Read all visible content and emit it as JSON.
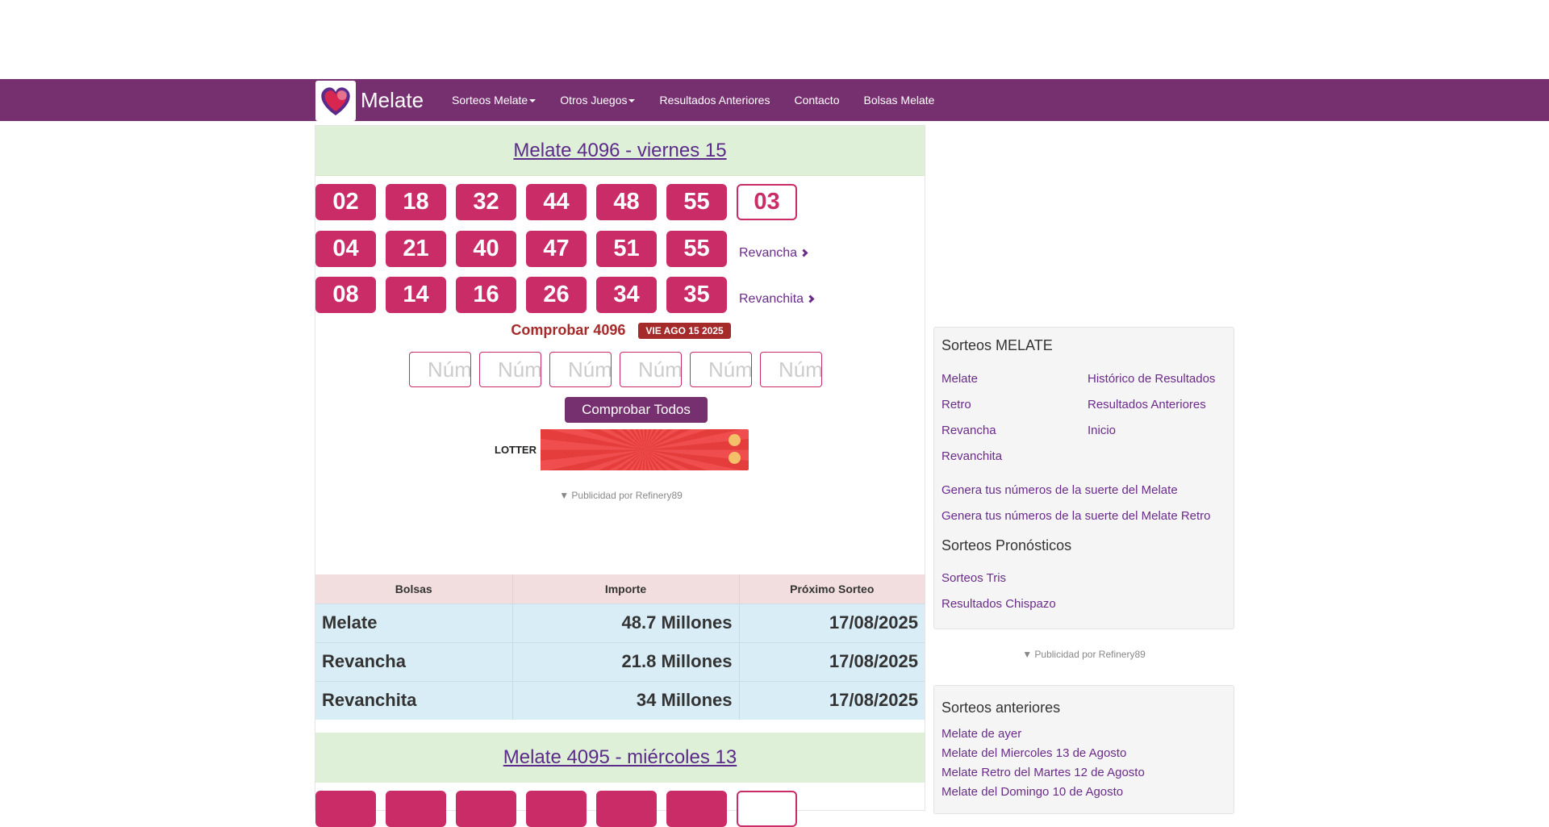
{
  "nav": {
    "brand": "Melate",
    "items": [
      "Sorteos Melate",
      "Otros Juegos",
      "Resultados Anteriores",
      "Contacto",
      "Bolsas Melate"
    ]
  },
  "draw": {
    "title": "Melate 4096 - viernes 15",
    "melate": [
      "02",
      "18",
      "32",
      "44",
      "48",
      "55"
    ],
    "extra": "03",
    "revancha": [
      "04",
      "21",
      "40",
      "47",
      "51",
      "55"
    ],
    "revancha_label": "Revancha",
    "revanchita": [
      "08",
      "14",
      "16",
      "26",
      "34",
      "35"
    ],
    "revanchita_label": "Revanchita"
  },
  "check": {
    "title": "Comprobar 4096",
    "date": "VIE AGO 15 2025",
    "placeholder": "Núm",
    "button": "Comprobar Todos"
  },
  "ad": {
    "logo": "LOTTER",
    "note": "▼ Publicidad por Refinery89"
  },
  "jackpot": {
    "headers": [
      "Bolsas",
      "Importe",
      "Próximo Sorteo"
    ],
    "rows": [
      [
        "Melate",
        "48.7 Millones",
        "17/08/2025"
      ],
      [
        "Revancha",
        "21.8 Millones",
        "17/08/2025"
      ],
      [
        "Revanchita",
        "34 Millones",
        "17/08/2025"
      ]
    ]
  },
  "draw2": {
    "title": "Melate 4095 - miércoles 13"
  },
  "sidebar": {
    "sorteos_title": "Sorteos MELATE",
    "sorteos_links_left": [
      "Melate",
      "Retro",
      "Revancha",
      "Revanchita"
    ],
    "sorteos_links_right": [
      "Histórico de Resultados",
      "Resultados Anteriores",
      "Inicio"
    ],
    "genera": [
      "Genera tus números de la suerte del Melate",
      "Genera tus números de la suerte del Melate Retro"
    ],
    "pronosticos_title": "Sorteos Pronósticos",
    "pronosticos_links": [
      "Sorteos Tris",
      "Resultados Chispazo"
    ],
    "ad_note": "▼ Publicidad por Refinery89",
    "anteriores_title": "Sorteos anteriores",
    "anteriores_links": [
      "Melate de ayer",
      "Melate del Miercoles 13 de Agosto",
      "Melate Retro del Martes 12 de Agosto",
      "Melate del Domingo 10 de Agosto"
    ]
  },
  "colors": {
    "nav": "#76306f",
    "ball": "#c92c67",
    "accent": "#a52a2a"
  }
}
